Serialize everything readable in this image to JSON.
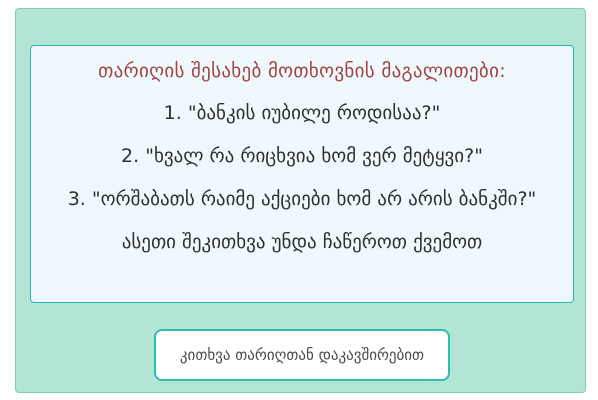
{
  "info": {
    "title": "თარიღის შესახებ მოთხოვნის მაგალითები:",
    "examples": [
      "1. \"ბანკის იუბილე როდისაა?\"",
      "2. \"ხვალ რა რიცხვია ხომ ვერ მეტყვი?\"",
      "3. \"ორშაბათს რაიმე აქციები ხომ არ არის ბანკში?\""
    ],
    "footer": "ასეთი შეკითხვა უნდა ჩაწეროთ ქვემოთ"
  },
  "button": {
    "label": "კითხვა თარიღთან დაკავშირებით"
  },
  "colors": {
    "panel_bg": "#b2e5d3",
    "box_bg": "#eff9fd",
    "accent_border": "#26b7b0",
    "title_text": "#a0423f"
  }
}
